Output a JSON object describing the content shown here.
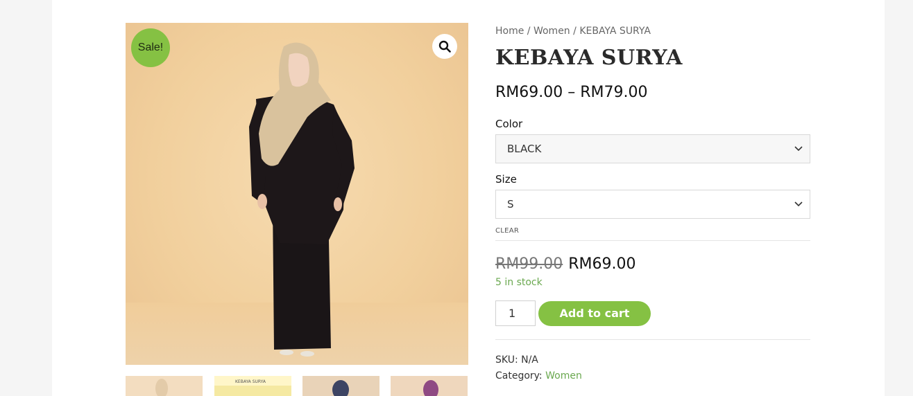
{
  "gallery": {
    "sale_badge": "Sale!",
    "zoom_icon": "magnifier-icon",
    "thumbnail_text": "KEBAYA SURYA",
    "thumbnails": [
      "thumb-1",
      "thumb-2",
      "thumb-3",
      "thumb-4"
    ]
  },
  "breadcrumb": {
    "home": "Home",
    "sep1": " / ",
    "category": "Women",
    "sep2": " / ",
    "current": "KEBAYA SURYA"
  },
  "product": {
    "title": "KEBAYA SURYA",
    "price_range": "RM69.00 – RM79.00",
    "color_label": "Color",
    "color_value": "BLACK",
    "size_label": "Size",
    "size_value": "S",
    "clear_label": "CLEAR",
    "old_price": "RM99.00",
    "new_price": "RM69.00",
    "stock": "5 in stock",
    "quantity": "1",
    "add_to_cart": "Add to cart",
    "sku_label": "SKU: ",
    "sku_value": "N/A",
    "category_label": "Category: ",
    "category_value": "Women"
  },
  "colors": {
    "accent": "#85c143",
    "stock": "#6aa84f",
    "image_bg": "#f2d2a2"
  }
}
